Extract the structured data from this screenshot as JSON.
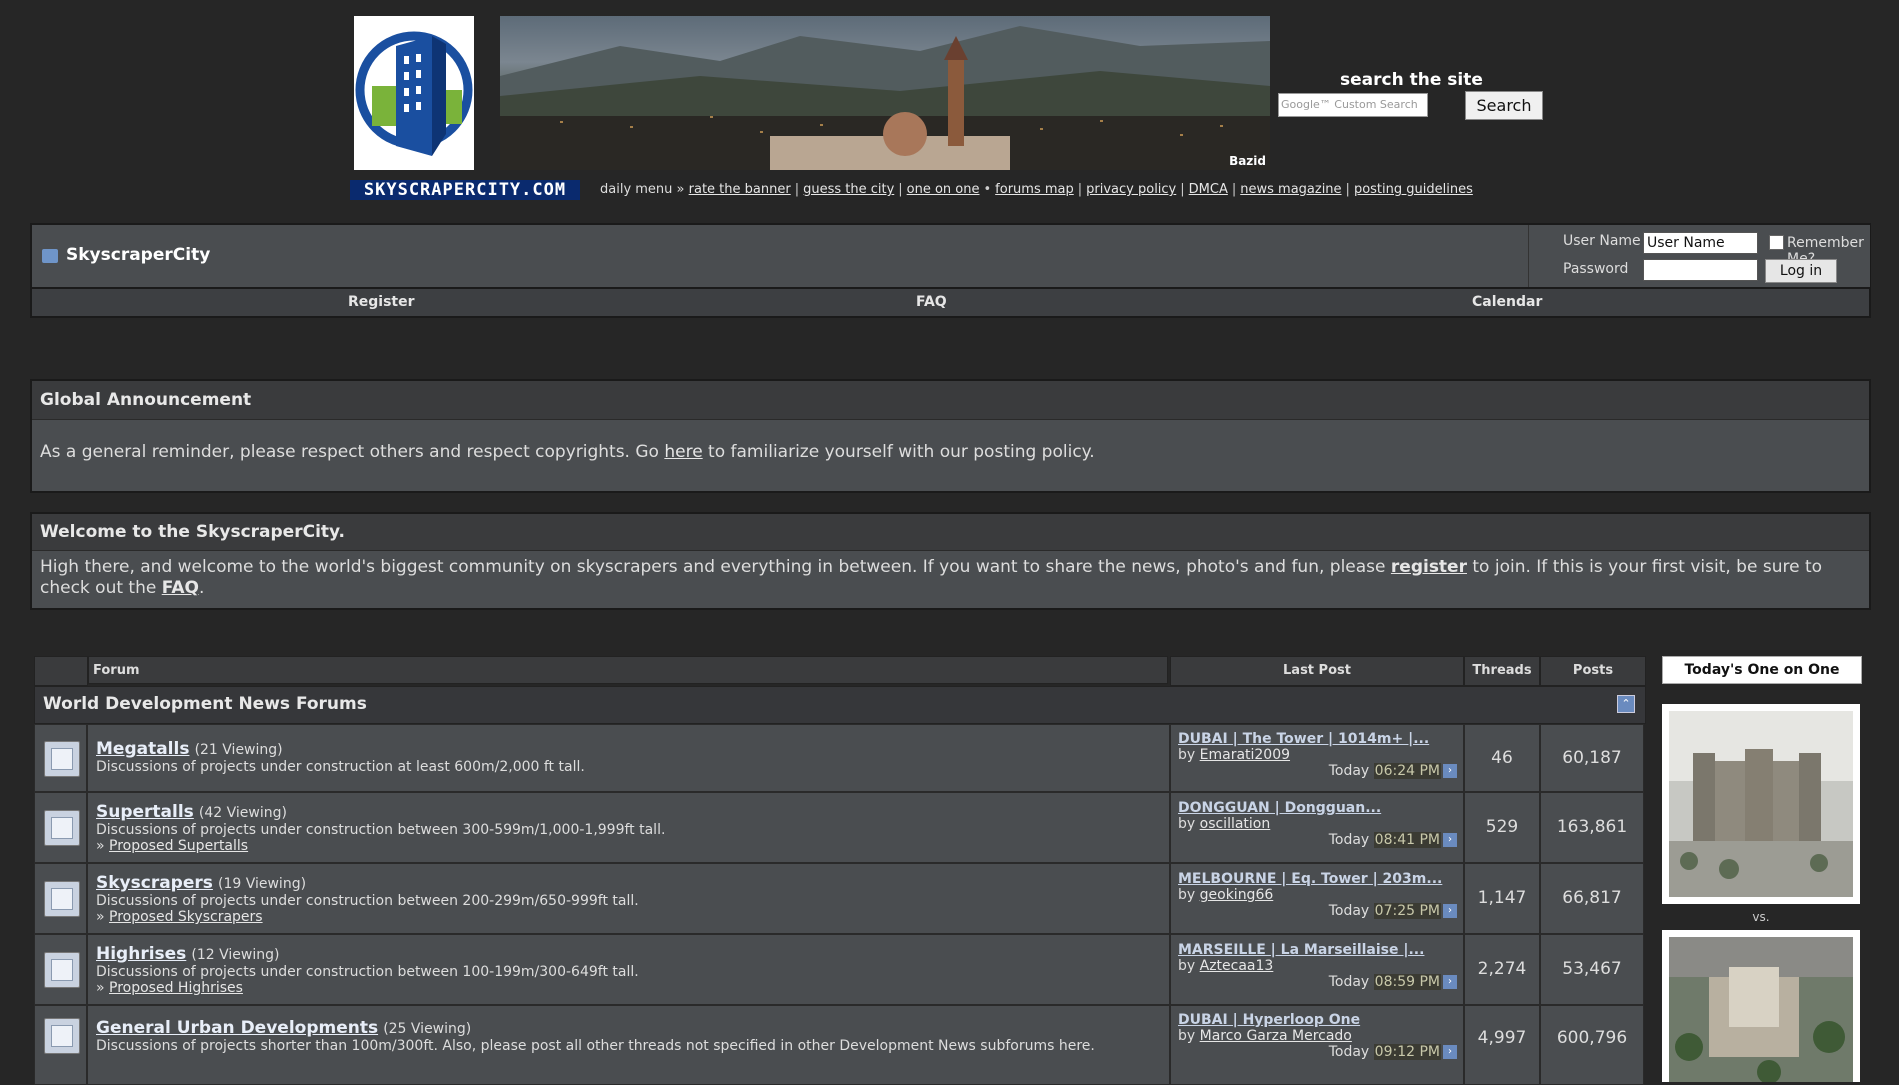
{
  "header": {
    "logo_text": "SKYSCRAPERCITY.COM",
    "banner_credit": "Bazid",
    "search_title": "search the site",
    "search_placeholder": "Google™ Custom Search",
    "search_button": "Search",
    "daily_prefix": "daily menu »",
    "daily_links": [
      "rate the banner",
      "guess the city",
      "one on one",
      "forums map",
      "privacy policy",
      "DMCA",
      "news magazine",
      "posting guidelines"
    ]
  },
  "navbar": {
    "title": "SkyscraperCity",
    "username_label": "User Name",
    "username_value": "User Name",
    "remember_label": "Remember Me?",
    "password_label": "Password",
    "login_button": "Log in",
    "links": [
      "Register",
      "FAQ",
      "Calendar"
    ]
  },
  "announcement": {
    "title": "Global Announcement",
    "text_before": "As a general reminder, please respect others and respect copyrights. Go ",
    "link": "here",
    "text_after": " to familiarize yourself with our posting policy."
  },
  "welcome": {
    "title": "Welcome to the SkyscraperCity.",
    "text_before": "High there, and welcome to the world's biggest community on skyscrapers and everything in between. If you want to share the news, photo's and fun, please ",
    "register_link": "register",
    "text_middle": " to join. If this is your first visit, be sure to check out the ",
    "faq_link": "FAQ",
    "text_after": "."
  },
  "forum_table": {
    "headers": {
      "forum": "Forum",
      "last_post": "Last Post",
      "threads": "Threads",
      "posts": "Posts"
    },
    "category": "World Development News Forums",
    "rows": [
      {
        "name": "Megatalls",
        "viewing": "(21 Viewing)",
        "desc": "Discussions of projects under construction at least 600m/2,000 ft tall.",
        "sub": "",
        "lp_title": "DUBAI | The Tower | 1014m+ |...",
        "lp_by": "by ",
        "lp_user": "Emarati2009",
        "lp_day": "Today ",
        "lp_time": "06:24 PM",
        "threads": "46",
        "posts": "60,187"
      },
      {
        "name": "Supertalls",
        "viewing": "(42 Viewing)",
        "desc": "Discussions of projects under construction between 300-599m/1,000-1,999ft tall.",
        "sub": "Proposed Supertalls",
        "lp_title": "DONGGUAN | Dongguan...",
        "lp_by": "by ",
        "lp_user": "oscillation",
        "lp_day": "Today ",
        "lp_time": "08:41 PM",
        "threads": "529",
        "posts": "163,861"
      },
      {
        "name": "Skyscrapers",
        "viewing": "(19 Viewing)",
        "desc": "Discussions of projects under construction between 200-299m/650-999ft tall.",
        "sub": "Proposed Skyscrapers",
        "lp_title": "MELBOURNE | Eq. Tower | 203m...",
        "lp_by": "by ",
        "lp_user": "geoking66",
        "lp_day": "Today ",
        "lp_time": "07:25 PM",
        "threads": "1,147",
        "posts": "66,817"
      },
      {
        "name": "Highrises",
        "viewing": "(12 Viewing)",
        "desc": "Discussions of projects under construction between 100-199m/300-649ft tall.",
        "sub": "Proposed Highrises",
        "lp_title": "MARSEILLE | La Marseillaise |...",
        "lp_by": "by ",
        "lp_user": "Aztecaa13",
        "lp_day": "Today ",
        "lp_time": "08:59 PM",
        "threads": "2,274",
        "posts": "53,467"
      },
      {
        "name": "General Urban Developments",
        "viewing": "(25 Viewing)",
        "desc": "Discussions of projects shorter than 100m/300ft. Also, please post all other threads not specified in other Development News subforums here.",
        "sub": "",
        "lp_title": "DUBAI | Hyperloop One",
        "lp_by": "by ",
        "lp_user": "Marco Garza Mercado",
        "lp_day": "Today ",
        "lp_time": "09:12 PM",
        "threads": "4,997",
        "posts": "600,796"
      }
    ]
  },
  "sidebar": {
    "title": "Today's One on One",
    "vs": "vs."
  }
}
